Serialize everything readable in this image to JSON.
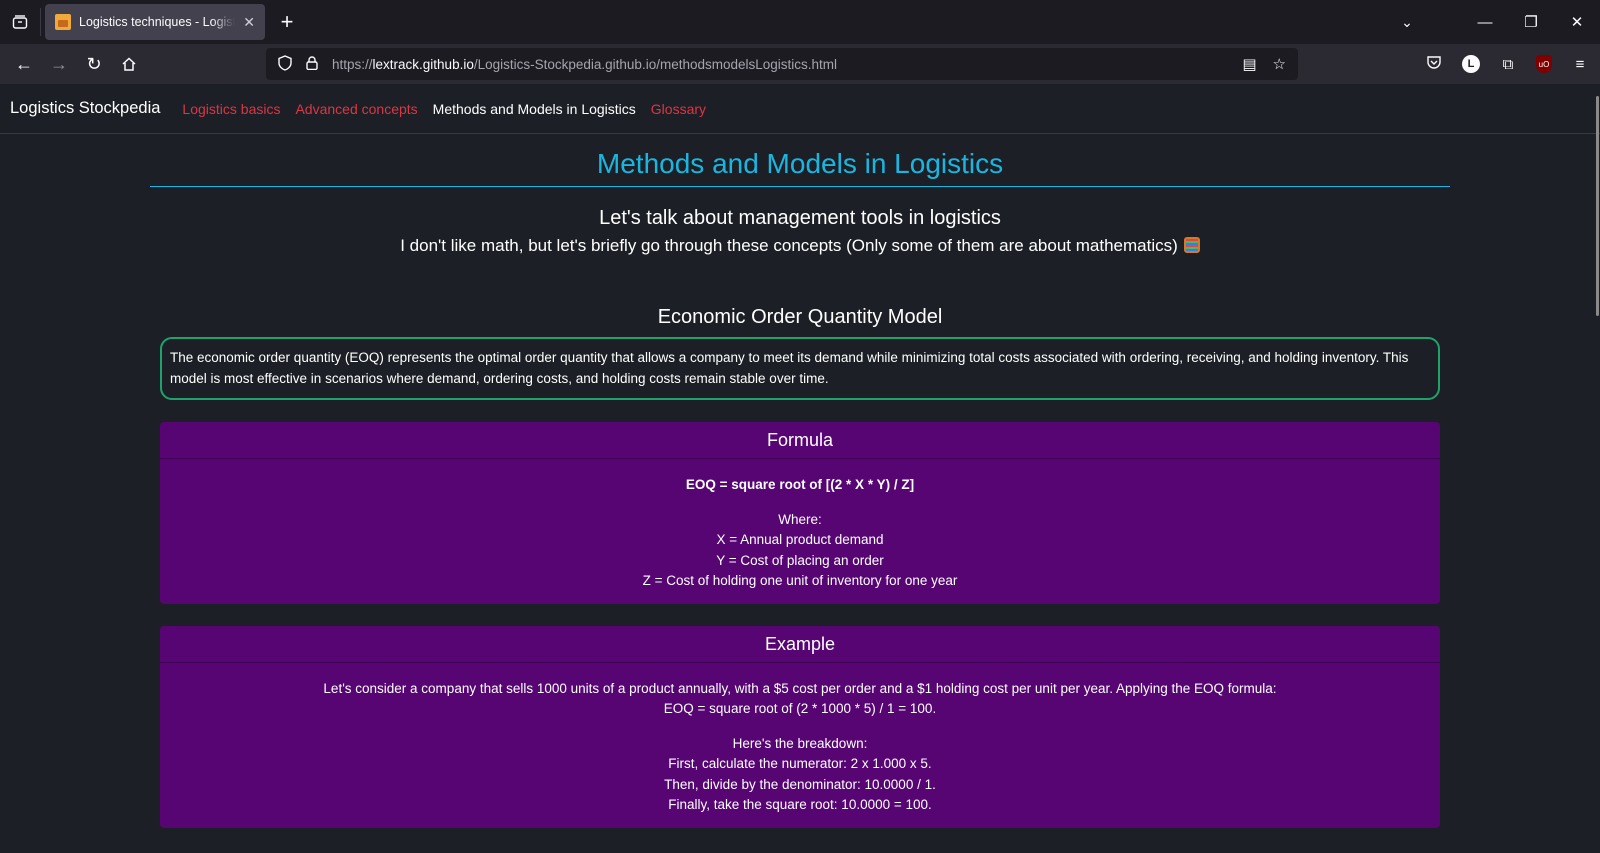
{
  "browser": {
    "tab_title": "Logistics techniques - Logistics Stockpedia",
    "url_host": "lextrack.github.io",
    "url_prefix": "https://",
    "url_path": "/Logistics-Stockpedia.github.io/methodsmodelsLogistics.html",
    "profile_initial": "L"
  },
  "site": {
    "brand": "Logistics Stockpedia",
    "nav": [
      {
        "label": "Logistics basics",
        "active": false
      },
      {
        "label": "Advanced concepts",
        "active": false
      },
      {
        "label": "Methods and Models in Logistics",
        "active": true
      },
      {
        "label": "Glossary",
        "active": false
      }
    ],
    "colors": {
      "accent": "#1ab6e0",
      "link": "#dc3545",
      "card": "#560573",
      "box_border": "#20a36b"
    }
  },
  "page": {
    "title": "Methods and Models in Logistics",
    "lead1": "Let's talk about management tools in logistics",
    "lead2": "I don't like math, but let's briefly go through these concepts (Only some of them are about mathematics)",
    "section_title": "Economic Order Quantity Model",
    "description": "The economic order quantity (EOQ) represents the optimal order quantity that allows a company to meet its demand while minimizing total costs associated with ordering, receiving, and holding inventory. This model is most effective in scenarios where demand, ordering costs, and holding costs remain stable over time.",
    "formula_card": {
      "header": "Formula",
      "formula": "EOQ = square root of [(2 * X * Y) / Z]",
      "where": "Where:",
      "x": "X = Annual product demand",
      "y": "Y = Cost of placing an order",
      "z": "Z = Cost of holding one unit of inventory for one year"
    },
    "example_card": {
      "header": "Example",
      "line1": "Let's consider a company that sells 1000 units of a product annually, with a $5 cost per order and a $1 holding cost per unit per year. Applying the EOQ formula:",
      "line2": "EOQ = square root of (2 * 1000 * 5) / 1 = 100.",
      "breakdown": "Here's the breakdown:",
      "step1": "First, calculate the numerator: 2 x 1.000 x 5.",
      "step2": "Then, divide by the denominator: 10.0000 / 1.",
      "step3": "Finally, take the square root: 10.0000 = 100."
    }
  }
}
